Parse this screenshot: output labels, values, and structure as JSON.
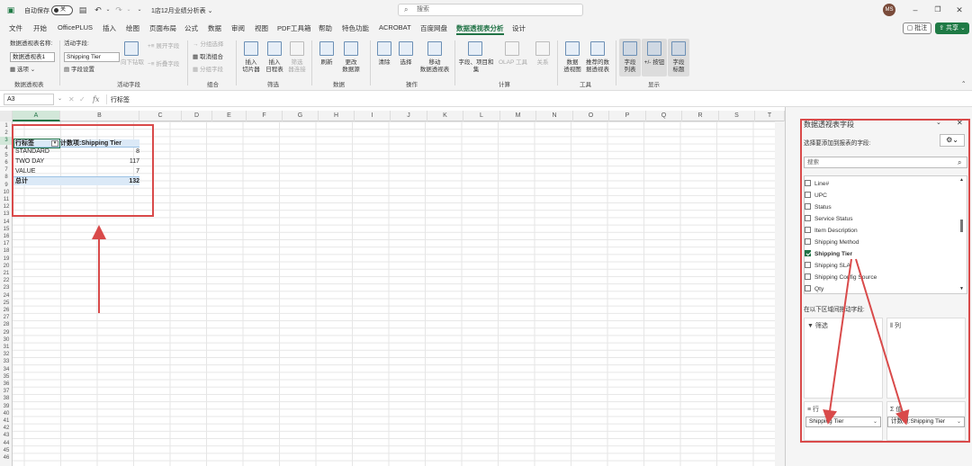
{
  "titlebar": {
    "autosave_label": "自动保存",
    "autosave_state": "关",
    "file_name": "1店12月业绩分析表",
    "search_placeholder": "搜索",
    "avatar_initials": "MS"
  },
  "menu": {
    "tabs": [
      "文件",
      "开始",
      "OfficePLUS",
      "插入",
      "绘图",
      "页面布局",
      "公式",
      "数据",
      "审阅",
      "视图",
      "PDF工具箱",
      "帮助",
      "特色功能",
      "ACROBAT",
      "百度网盘",
      "数据透视表分析",
      "设计"
    ],
    "active_tab": "数据透视表分析",
    "comment_label": "批注",
    "share_label": "共享"
  },
  "ribbon": {
    "pivot_name_label": "数据透视表名称:",
    "pivot_name_value": "数据透视表1",
    "options_label": "选项",
    "group_pivot": "数据透视表",
    "active_field_label": "活动字段:",
    "active_field_value": "Shipping Tier",
    "field_settings": "字段设置",
    "drill_down": "向下钻取",
    "drill_up": "向上钻",
    "expand_field": "展开字段",
    "collapse_field": "折叠字段",
    "group_active_field": "活动字段",
    "group_selection": "分组选择",
    "ungroup": "取消组合",
    "group_field": "分组字段",
    "group_group": "组合",
    "insert_slicer": "插入\n切片器",
    "insert_timeline": "插入\n日程表",
    "filter_connections": "筛选\n器连接",
    "group_filter": "筛选",
    "refresh": "刷新",
    "change_source": "更改\n数据源",
    "group_data": "数据",
    "clear": "清除",
    "select": "选择",
    "move_pivot": "移动\n数据透视表",
    "group_actions": "操作",
    "fields_items": "字段、项目和\n集",
    "olap_tools": "OLAP 工具",
    "relationships": "关系",
    "group_calc": "计算",
    "pivot_chart": "数据\n透视图",
    "recommended": "推荐的数\n据透视表",
    "group_tools": "工具",
    "field_list_btn": "字段\n列表",
    "plus_minus_btn": "+/- 按钮",
    "field_headers_btn": "字段\n标题",
    "group_show": "显示"
  },
  "formula_bar": {
    "name_box": "A3",
    "fx": "fx",
    "content": "行标签"
  },
  "grid": {
    "columns": [
      "A",
      "B",
      "C",
      "D",
      "E",
      "F",
      "G",
      "H",
      "I",
      "J",
      "K",
      "L",
      "M",
      "N",
      "O",
      "P",
      "Q",
      "R",
      "S",
      "T"
    ],
    "rows": [
      "1",
      "2",
      "3",
      "4",
      "5",
      "6",
      "7",
      "8",
      "9",
      "10",
      "11",
      "12",
      "13",
      "14",
      "15",
      "16",
      "17",
      "18",
      "19",
      "20",
      "21",
      "22",
      "23",
      "24",
      "25",
      "26",
      "27",
      "28",
      "29",
      "30",
      "31",
      "32",
      "33",
      "34",
      "35",
      "36",
      "37",
      "38",
      "39",
      "40",
      "41",
      "42",
      "43",
      "44",
      "45",
      "46"
    ]
  },
  "pivot": {
    "header_row_label": "行标签",
    "header_value": "计数项:Shipping Tier",
    "rows": [
      {
        "label": "STANDARD",
        "value": "8"
      },
      {
        "label": "TWO DAY",
        "value": "117"
      },
      {
        "label": "VALUE",
        "value": "7"
      }
    ],
    "total_label": "总计",
    "total_value": "132"
  },
  "pane": {
    "title": "数据透视表字段",
    "choose_fields": "选择要添加到报表的字段:",
    "search_placeholder": "搜索",
    "fields": [
      {
        "name": "Line#",
        "checked": false
      },
      {
        "name": "UPC",
        "checked": false
      },
      {
        "name": "Status",
        "checked": false
      },
      {
        "name": "Service Status",
        "checked": false
      },
      {
        "name": "Item Description",
        "checked": false
      },
      {
        "name": "Shipping Method",
        "checked": false
      },
      {
        "name": "Shipping Tier",
        "checked": true
      },
      {
        "name": "Shipping SLA",
        "checked": false
      },
      {
        "name": "Shipping Config Source",
        "checked": false
      },
      {
        "name": "Qty",
        "checked": false
      }
    ],
    "drag_label": "在以下区域间拖动字段:",
    "filter_area": "筛选",
    "columns_area": "列",
    "rows_area": "行",
    "values_area": "值",
    "rows_field": "Shipping Tier",
    "values_field": "计数项:Shipping Tier"
  },
  "colors": {
    "accent": "#217346",
    "annotation": "#d94a4a"
  }
}
